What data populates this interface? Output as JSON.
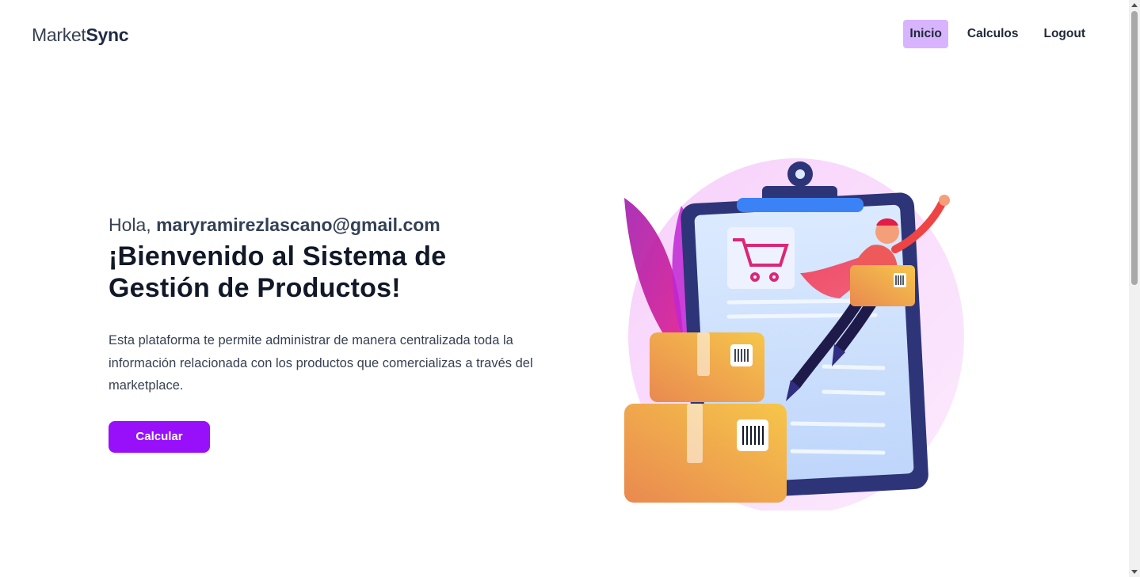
{
  "brand": {
    "part1": "Market",
    "part2": "Sync"
  },
  "nav": {
    "items": [
      {
        "label": "Inicio",
        "active": true
      },
      {
        "label": "Calculos",
        "active": false
      },
      {
        "label": "Logout",
        "active": false
      }
    ]
  },
  "hero": {
    "greeting": "Hola,",
    "user_email": "maryramirezlascano@gmail.com",
    "title_line1": "¡Bienvenido al Sistema de",
    "title_line2": "Gestión de Productos!",
    "description": "Esta plataforma te permite administrar de manera centralizada toda la información relacionada con los productos que comercializas a través del marketplace.",
    "button_label": "Calcular"
  },
  "colors": {
    "accent": "#9810fa",
    "nav_active_bg": "#d8b4fe",
    "illustration_blob": "#f5d0fe",
    "box_orange": "#f2a84a"
  },
  "illustration": {
    "icon": "delivery-clipboard-illustration"
  }
}
